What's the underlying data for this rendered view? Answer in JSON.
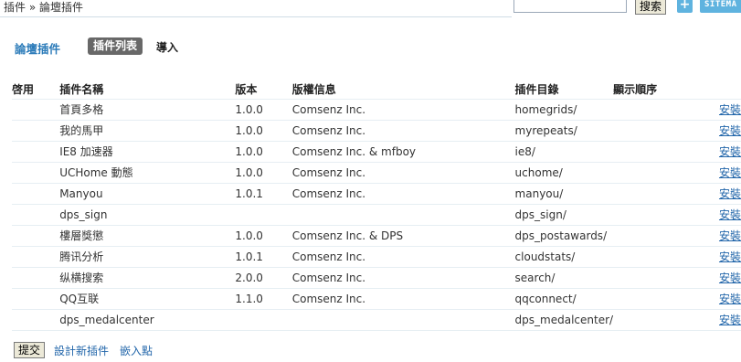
{
  "breadcrumb": "插件 » 論壇插件",
  "search": {
    "placeholder": "",
    "button": "搜索"
  },
  "topbar": {
    "plus": "+",
    "sitemap": "SITEMA"
  },
  "page": {
    "title": "論壇插件",
    "tabs": [
      "插件列表",
      "導入"
    ]
  },
  "columns": [
    "啓用",
    "插件名稱",
    "版本",
    "版權信息",
    "插件目錄",
    "顯示順序",
    ""
  ],
  "plugins": [
    {
      "name": "首頁多格",
      "version": "1.0.0",
      "copyright": "Comsenz Inc.",
      "dir": "homegrids/",
      "action": "安裝"
    },
    {
      "name": "我的馬甲",
      "version": "1.0.0",
      "copyright": "Comsenz Inc.",
      "dir": "myrepeats/",
      "action": "安裝"
    },
    {
      "name": "IE8 加速器",
      "version": "1.0.0",
      "copyright": "Comsenz Inc. & mfboy",
      "dir": "ie8/",
      "action": "安裝"
    },
    {
      "name": "UCHome 動態",
      "version": "1.0.0",
      "copyright": "Comsenz Inc.",
      "dir": "uchome/",
      "action": "安裝"
    },
    {
      "name": "Manyou",
      "version": "1.0.1",
      "copyright": "Comsenz Inc.",
      "dir": "manyou/",
      "action": "安裝"
    },
    {
      "name": "dps_sign",
      "version": "",
      "copyright": "",
      "dir": "dps_sign/",
      "action": "安裝"
    },
    {
      "name": "樓層獎懲",
      "version": "1.0.0",
      "copyright": "Comsenz Inc. & DPS",
      "dir": "dps_postawards/",
      "action": "安裝"
    },
    {
      "name": "腾讯分析",
      "version": "1.0.1",
      "copyright": "Comsenz Inc.",
      "dir": "cloudstats/",
      "action": "安裝"
    },
    {
      "name": "纵横搜索",
      "version": "2.0.0",
      "copyright": "Comsenz Inc.",
      "dir": "search/",
      "action": "安裝"
    },
    {
      "name": "QQ互联",
      "version": "1.1.0",
      "copyright": "Comsenz Inc.",
      "dir": "qqconnect/",
      "action": "安裝"
    },
    {
      "name": "dps_medalcenter",
      "version": "",
      "copyright": "",
      "dir": "dps_medalcenter/",
      "action": "安裝"
    }
  ],
  "footer": {
    "submit": "提交",
    "design_link": "設計新插件",
    "hooks_link": "嵌入點"
  }
}
